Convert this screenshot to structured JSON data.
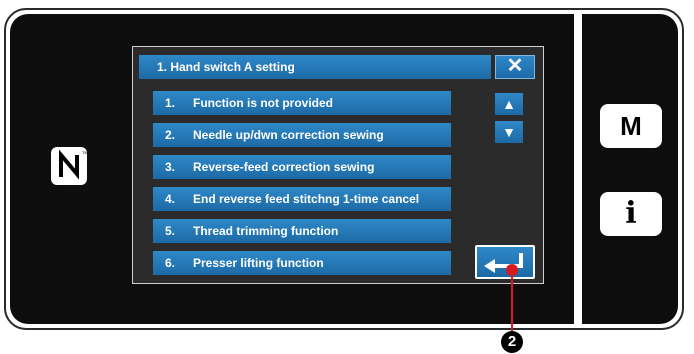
{
  "dialog": {
    "title": "1.    Hand switch A setting",
    "close_icon": "close-x-icon"
  },
  "options": [
    {
      "num": "1.",
      "label": "Function is not provided"
    },
    {
      "num": "2.",
      "label": "Needle up/dwn correction sewing"
    },
    {
      "num": "3.",
      "label": "Reverse-feed correction sewing"
    },
    {
      "num": "4.",
      "label": "End reverse feed stitchng 1-time cancel"
    },
    {
      "num": "5.",
      "label": "Thread trimming function"
    },
    {
      "num": "6.",
      "label": "Presser lifting function"
    }
  ],
  "scroll": {
    "up_icon": "triangle-up-icon",
    "down_icon": "triangle-down-icon"
  },
  "enter_icon": "enter-return-icon",
  "side_buttons": {
    "m_label": "M",
    "info_label": "i"
  },
  "nfc_icon": "nfc-icon",
  "callout": {
    "label": "2"
  },
  "colors": {
    "button_blue": "#1f75b8",
    "panel_bg": "#0d0d0d",
    "callout_red": "#d81a20"
  }
}
